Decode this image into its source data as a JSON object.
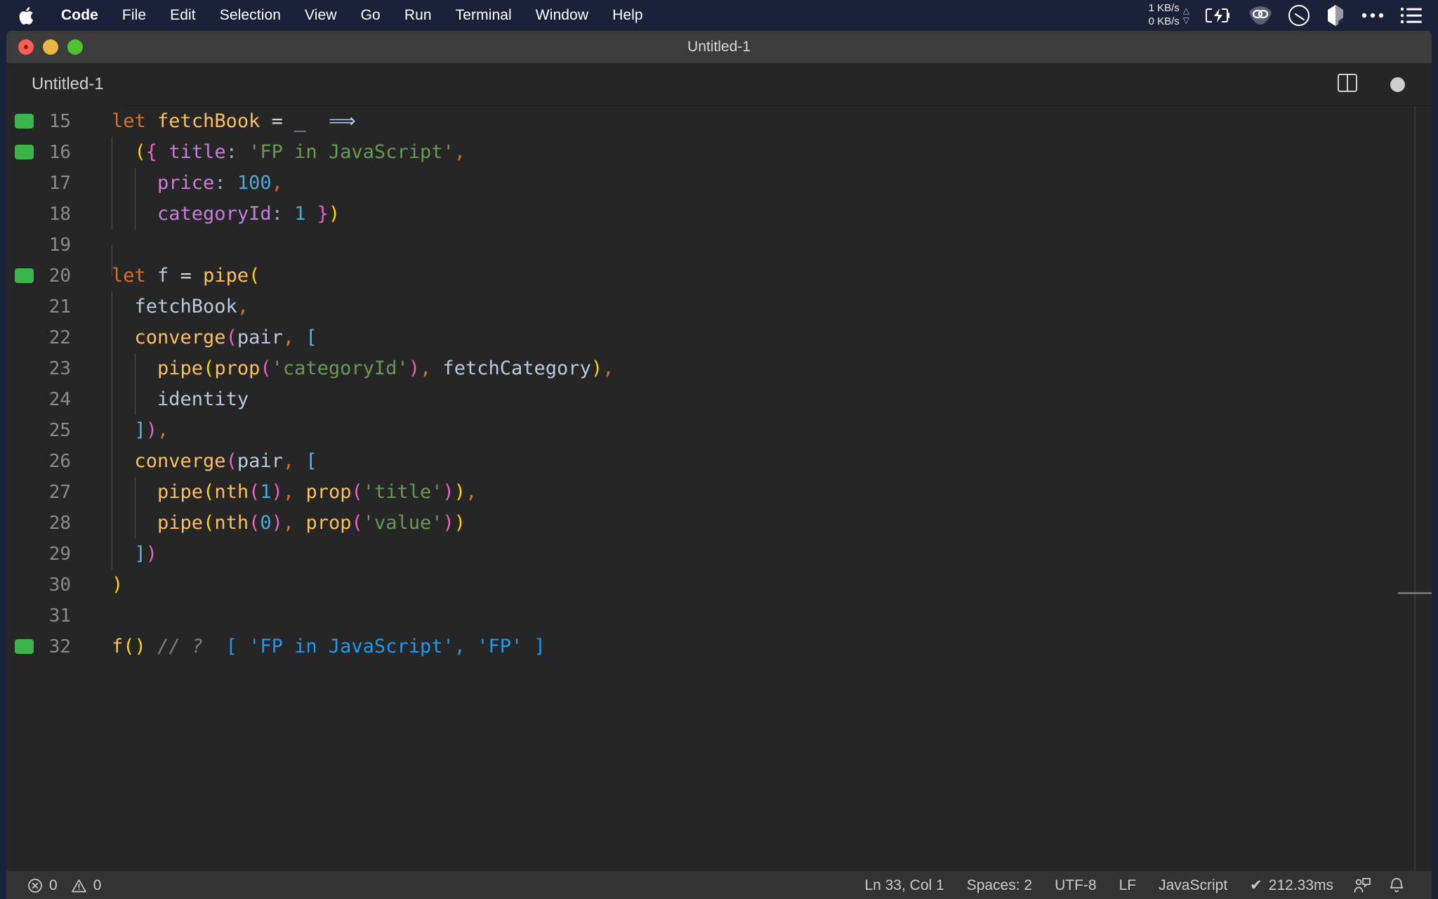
{
  "menubar": {
    "apple_icon": "apple-logo-icon",
    "items": [
      {
        "label": "Code",
        "bold": true
      },
      {
        "label": "File",
        "bold": false
      },
      {
        "label": "Edit",
        "bold": false
      },
      {
        "label": "Selection",
        "bold": false
      },
      {
        "label": "View",
        "bold": false
      },
      {
        "label": "Go",
        "bold": false
      },
      {
        "label": "Run",
        "bold": false
      },
      {
        "label": "Terminal",
        "bold": false
      },
      {
        "label": "Window",
        "bold": false
      },
      {
        "label": "Help",
        "bold": false
      }
    ],
    "tray": {
      "net_up": "1 KB/s",
      "net_down": "0 KB/s",
      "up_arrow": "△",
      "down_arrow": "▽",
      "icons": [
        "battery-charging-icon",
        "vpn-eye-icon",
        "clock-dial-icon",
        "dropbox-icon",
        "more-dots-icon",
        "control-center-list-icon"
      ]
    }
  },
  "window": {
    "title": "Untitled-1",
    "traffic_lights": [
      "close-button",
      "minimize-button",
      "maximize-button"
    ]
  },
  "tabbar": {
    "tab_label": "Untitled-1",
    "actions": [
      "split-editor-icon",
      "unsaved-dot-indicator"
    ]
  },
  "editor": {
    "language": "JavaScript",
    "lines": [
      {
        "num": "15",
        "marked": true,
        "indent_guides": 0,
        "tokens": [
          {
            "t": "let",
            "c": "t-kw"
          },
          {
            "t": " ",
            "c": ""
          },
          {
            "t": "fetchBook",
            "c": "t-fn"
          },
          {
            "t": " ",
            "c": ""
          },
          {
            "t": "=",
            "c": "t-op"
          },
          {
            "t": " ",
            "c": ""
          },
          {
            "t": "_",
            "c": "t-var"
          },
          {
            "t": "  ",
            "c": ""
          },
          {
            "t": "⟹",
            "c": "t-arrow"
          }
        ]
      },
      {
        "num": "16",
        "marked": true,
        "indent_guides": 1,
        "tokens": [
          {
            "t": "  ",
            "c": ""
          },
          {
            "t": "(",
            "c": "t-b1"
          },
          {
            "t": "{",
            "c": "t-b2"
          },
          {
            "t": " ",
            "c": ""
          },
          {
            "t": "title",
            "c": "t-prop"
          },
          {
            "t": ":",
            "c": "t-colon"
          },
          {
            "t": " ",
            "c": ""
          },
          {
            "t": "'FP in JavaScript'",
            "c": "t-str"
          },
          {
            "t": ",",
            "c": "t-comma"
          }
        ]
      },
      {
        "num": "17",
        "marked": false,
        "indent_guides": 2,
        "tokens": [
          {
            "t": "    ",
            "c": ""
          },
          {
            "t": "price",
            "c": "t-prop"
          },
          {
            "t": ":",
            "c": "t-colon"
          },
          {
            "t": " ",
            "c": ""
          },
          {
            "t": "100",
            "c": "t-num"
          },
          {
            "t": ",",
            "c": "t-comma"
          }
        ]
      },
      {
        "num": "18",
        "marked": false,
        "indent_guides": 2,
        "tokens": [
          {
            "t": "    ",
            "c": ""
          },
          {
            "t": "categoryId",
            "c": "t-prop"
          },
          {
            "t": ":",
            "c": "t-colon"
          },
          {
            "t": " ",
            "c": ""
          },
          {
            "t": "1",
            "c": "t-num"
          },
          {
            "t": " ",
            "c": ""
          },
          {
            "t": "}",
            "c": "t-b2"
          },
          {
            "t": ")",
            "c": "t-b1"
          }
        ]
      },
      {
        "num": "19",
        "marked": false,
        "indent_guides": 1,
        "tokens": []
      },
      {
        "num": "20",
        "marked": true,
        "indent_guides": 0,
        "tokens": [
          {
            "t": "let",
            "c": "t-kw"
          },
          {
            "t": " ",
            "c": ""
          },
          {
            "t": "f",
            "c": "t-var"
          },
          {
            "t": " ",
            "c": ""
          },
          {
            "t": "=",
            "c": "t-op"
          },
          {
            "t": " ",
            "c": ""
          },
          {
            "t": "pipe",
            "c": "t-fn"
          },
          {
            "t": "(",
            "c": "t-b1"
          }
        ]
      },
      {
        "num": "21",
        "marked": false,
        "indent_guides": 1,
        "tokens": [
          {
            "t": "  ",
            "c": ""
          },
          {
            "t": "fetchBook",
            "c": "t-var"
          },
          {
            "t": ",",
            "c": "t-comma"
          }
        ]
      },
      {
        "num": "22",
        "marked": false,
        "indent_guides": 1,
        "tokens": [
          {
            "t": "  ",
            "c": ""
          },
          {
            "t": "converge",
            "c": "t-fn"
          },
          {
            "t": "(",
            "c": "t-b2"
          },
          {
            "t": "pair",
            "c": "t-var"
          },
          {
            "t": ",",
            "c": "t-comma"
          },
          {
            "t": " ",
            "c": ""
          },
          {
            "t": "[",
            "c": "t-b3"
          }
        ]
      },
      {
        "num": "23",
        "marked": false,
        "indent_guides": 2,
        "tokens": [
          {
            "t": "    ",
            "c": ""
          },
          {
            "t": "pipe",
            "c": "t-fn"
          },
          {
            "t": "(",
            "c": "t-b1"
          },
          {
            "t": "prop",
            "c": "t-fn"
          },
          {
            "t": "(",
            "c": "t-b2"
          },
          {
            "t": "'categoryId'",
            "c": "t-str"
          },
          {
            "t": ")",
            "c": "t-b2"
          },
          {
            "t": ",",
            "c": "t-comma"
          },
          {
            "t": " ",
            "c": ""
          },
          {
            "t": "fetchCategory",
            "c": "t-var"
          },
          {
            "t": ")",
            "c": "t-b1"
          },
          {
            "t": ",",
            "c": "t-comma"
          }
        ]
      },
      {
        "num": "24",
        "marked": false,
        "indent_guides": 2,
        "tokens": [
          {
            "t": "    ",
            "c": ""
          },
          {
            "t": "identity",
            "c": "t-var"
          }
        ]
      },
      {
        "num": "25",
        "marked": false,
        "indent_guides": 1,
        "tokens": [
          {
            "t": "  ",
            "c": ""
          },
          {
            "t": "]",
            "c": "t-b3"
          },
          {
            "t": ")",
            "c": "t-b2"
          },
          {
            "t": ",",
            "c": "t-comma"
          }
        ]
      },
      {
        "num": "26",
        "marked": false,
        "indent_guides": 1,
        "tokens": [
          {
            "t": "  ",
            "c": ""
          },
          {
            "t": "converge",
            "c": "t-fn"
          },
          {
            "t": "(",
            "c": "t-b2"
          },
          {
            "t": "pair",
            "c": "t-var"
          },
          {
            "t": ",",
            "c": "t-comma"
          },
          {
            "t": " ",
            "c": ""
          },
          {
            "t": "[",
            "c": "t-b3"
          }
        ]
      },
      {
        "num": "27",
        "marked": false,
        "indent_guides": 2,
        "tokens": [
          {
            "t": "    ",
            "c": ""
          },
          {
            "t": "pipe",
            "c": "t-fn"
          },
          {
            "t": "(",
            "c": "t-b1"
          },
          {
            "t": "nth",
            "c": "t-fn"
          },
          {
            "t": "(",
            "c": "t-b2"
          },
          {
            "t": "1",
            "c": "t-num"
          },
          {
            "t": ")",
            "c": "t-b2"
          },
          {
            "t": ",",
            "c": "t-comma"
          },
          {
            "t": " ",
            "c": ""
          },
          {
            "t": "prop",
            "c": "t-fn"
          },
          {
            "t": "(",
            "c": "t-b2"
          },
          {
            "t": "'title'",
            "c": "t-str"
          },
          {
            "t": ")",
            "c": "t-b2"
          },
          {
            "t": ")",
            "c": "t-b1"
          },
          {
            "t": ",",
            "c": "t-comma"
          }
        ]
      },
      {
        "num": "28",
        "marked": false,
        "indent_guides": 2,
        "tokens": [
          {
            "t": "    ",
            "c": ""
          },
          {
            "t": "pipe",
            "c": "t-fn"
          },
          {
            "t": "(",
            "c": "t-b1"
          },
          {
            "t": "nth",
            "c": "t-fn"
          },
          {
            "t": "(",
            "c": "t-b2"
          },
          {
            "t": "0",
            "c": "t-num"
          },
          {
            "t": ")",
            "c": "t-b2"
          },
          {
            "t": ",",
            "c": "t-comma"
          },
          {
            "t": " ",
            "c": ""
          },
          {
            "t": "prop",
            "c": "t-fn"
          },
          {
            "t": "(",
            "c": "t-b2"
          },
          {
            "t": "'value'",
            "c": "t-str"
          },
          {
            "t": ")",
            "c": "t-b2"
          },
          {
            "t": ")",
            "c": "t-b1"
          }
        ]
      },
      {
        "num": "29",
        "marked": false,
        "indent_guides": 1,
        "tokens": [
          {
            "t": "  ",
            "c": ""
          },
          {
            "t": "]",
            "c": "t-b3"
          },
          {
            "t": ")",
            "c": "t-b2"
          }
        ]
      },
      {
        "num": "30",
        "marked": false,
        "indent_guides": 0,
        "tokens": [
          {
            "t": ")",
            "c": "t-b1"
          }
        ]
      },
      {
        "num": "31",
        "marked": false,
        "indent_guides": 0,
        "tokens": []
      },
      {
        "num": "32",
        "marked": true,
        "indent_guides": 0,
        "tokens": [
          {
            "t": "f",
            "c": "t-fn"
          },
          {
            "t": "(",
            "c": "t-b1"
          },
          {
            "t": ")",
            "c": "t-b1"
          },
          {
            "t": " ",
            "c": ""
          },
          {
            "t": "// ?",
            "c": "t-comment"
          },
          {
            "t": "  ",
            "c": ""
          },
          {
            "t": "[ 'FP in JavaScript', 'FP' ]",
            "c": "t-result"
          }
        ]
      }
    ]
  },
  "statusbar": {
    "errors": "0",
    "warnings": "0",
    "cursor": "Ln 33, Col 1",
    "indentation": "Spaces: 2",
    "encoding": "UTF-8",
    "eol": "LF",
    "language": "JavaScript",
    "run_time": "212.33ms",
    "run_check": "✔",
    "icons": [
      "error-circle-icon",
      "warning-triangle-icon",
      "feedback-icon",
      "bell-icon"
    ]
  }
}
